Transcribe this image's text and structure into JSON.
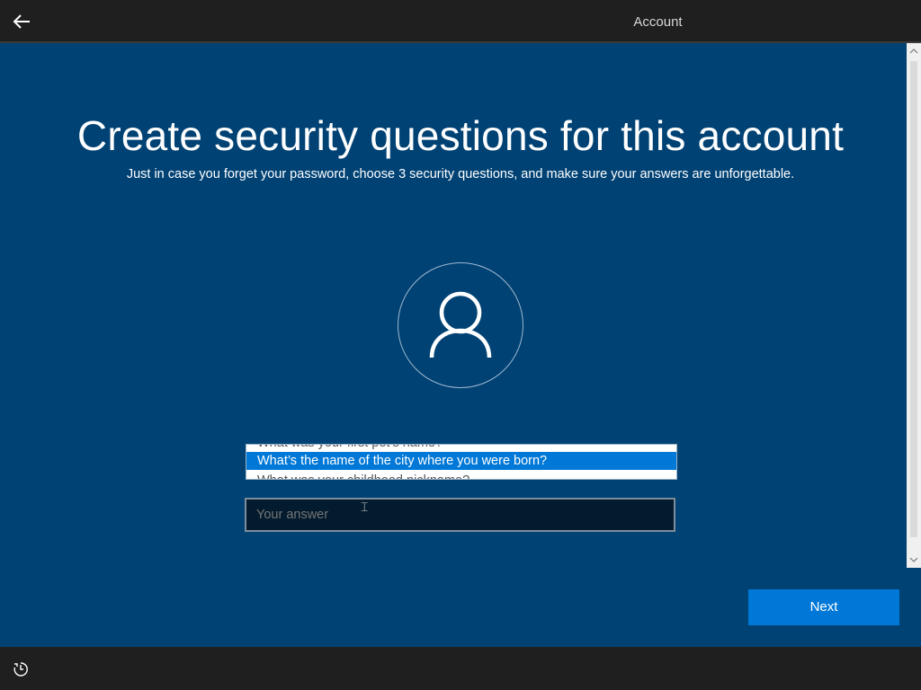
{
  "header": {
    "back_icon": "arrow-left-icon",
    "active_tab": "Account"
  },
  "main": {
    "title": "Create security questions for this account",
    "subtitle": "Just in case you forget your password, choose 3 security questions, and make sure your answers are unforgettable.",
    "avatar_icon": "person-icon"
  },
  "security_question_dropdown": {
    "options": [
      "What was your first pet’s name?",
      "What’s the name of the city where you were born?",
      "What was your childhood nickname?"
    ],
    "selected": "What’s the name of the city where you were born?"
  },
  "answer_field": {
    "placeholder": "Your answer",
    "value": ""
  },
  "footer": {
    "next_label": "Next",
    "ease_of_access_icon": "ease-of-access-icon"
  },
  "colors": {
    "background": "#004274",
    "accent": "#0078d7",
    "bar": "#1f1f1f"
  }
}
